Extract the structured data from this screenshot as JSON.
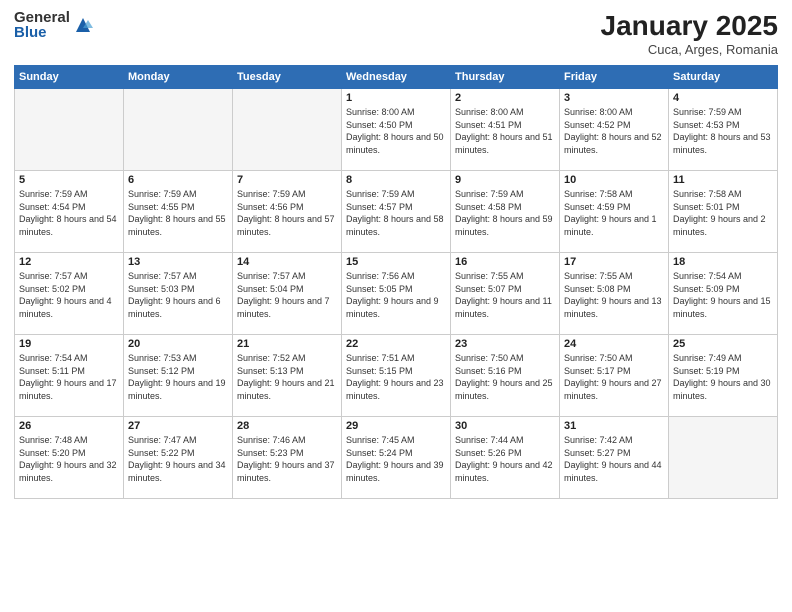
{
  "logo": {
    "general": "General",
    "blue": "Blue"
  },
  "header": {
    "month": "January 2025",
    "location": "Cuca, Arges, Romania"
  },
  "weekdays": [
    "Sunday",
    "Monday",
    "Tuesday",
    "Wednesday",
    "Thursday",
    "Friday",
    "Saturday"
  ],
  "weeks": [
    [
      {
        "day": "",
        "info": ""
      },
      {
        "day": "",
        "info": ""
      },
      {
        "day": "",
        "info": ""
      },
      {
        "day": "1",
        "sunrise": "Sunrise: 8:00 AM",
        "sunset": "Sunset: 4:50 PM",
        "daylight": "Daylight: 8 hours and 50 minutes."
      },
      {
        "day": "2",
        "sunrise": "Sunrise: 8:00 AM",
        "sunset": "Sunset: 4:51 PM",
        "daylight": "Daylight: 8 hours and 51 minutes."
      },
      {
        "day": "3",
        "sunrise": "Sunrise: 8:00 AM",
        "sunset": "Sunset: 4:52 PM",
        "daylight": "Daylight: 8 hours and 52 minutes."
      },
      {
        "day": "4",
        "sunrise": "Sunrise: 7:59 AM",
        "sunset": "Sunset: 4:53 PM",
        "daylight": "Daylight: 8 hours and 53 minutes."
      }
    ],
    [
      {
        "day": "5",
        "sunrise": "Sunrise: 7:59 AM",
        "sunset": "Sunset: 4:54 PM",
        "daylight": "Daylight: 8 hours and 54 minutes."
      },
      {
        "day": "6",
        "sunrise": "Sunrise: 7:59 AM",
        "sunset": "Sunset: 4:55 PM",
        "daylight": "Daylight: 8 hours and 55 minutes."
      },
      {
        "day": "7",
        "sunrise": "Sunrise: 7:59 AM",
        "sunset": "Sunset: 4:56 PM",
        "daylight": "Daylight: 8 hours and 57 minutes."
      },
      {
        "day": "8",
        "sunrise": "Sunrise: 7:59 AM",
        "sunset": "Sunset: 4:57 PM",
        "daylight": "Daylight: 8 hours and 58 minutes."
      },
      {
        "day": "9",
        "sunrise": "Sunrise: 7:59 AM",
        "sunset": "Sunset: 4:58 PM",
        "daylight": "Daylight: 8 hours and 59 minutes."
      },
      {
        "day": "10",
        "sunrise": "Sunrise: 7:58 AM",
        "sunset": "Sunset: 4:59 PM",
        "daylight": "Daylight: 9 hours and 1 minute."
      },
      {
        "day": "11",
        "sunrise": "Sunrise: 7:58 AM",
        "sunset": "Sunset: 5:01 PM",
        "daylight": "Daylight: 9 hours and 2 minutes."
      }
    ],
    [
      {
        "day": "12",
        "sunrise": "Sunrise: 7:57 AM",
        "sunset": "Sunset: 5:02 PM",
        "daylight": "Daylight: 9 hours and 4 minutes."
      },
      {
        "day": "13",
        "sunrise": "Sunrise: 7:57 AM",
        "sunset": "Sunset: 5:03 PM",
        "daylight": "Daylight: 9 hours and 6 minutes."
      },
      {
        "day": "14",
        "sunrise": "Sunrise: 7:57 AM",
        "sunset": "Sunset: 5:04 PM",
        "daylight": "Daylight: 9 hours and 7 minutes."
      },
      {
        "day": "15",
        "sunrise": "Sunrise: 7:56 AM",
        "sunset": "Sunset: 5:05 PM",
        "daylight": "Daylight: 9 hours and 9 minutes."
      },
      {
        "day": "16",
        "sunrise": "Sunrise: 7:55 AM",
        "sunset": "Sunset: 5:07 PM",
        "daylight": "Daylight: 9 hours and 11 minutes."
      },
      {
        "day": "17",
        "sunrise": "Sunrise: 7:55 AM",
        "sunset": "Sunset: 5:08 PM",
        "daylight": "Daylight: 9 hours and 13 minutes."
      },
      {
        "day": "18",
        "sunrise": "Sunrise: 7:54 AM",
        "sunset": "Sunset: 5:09 PM",
        "daylight": "Daylight: 9 hours and 15 minutes."
      }
    ],
    [
      {
        "day": "19",
        "sunrise": "Sunrise: 7:54 AM",
        "sunset": "Sunset: 5:11 PM",
        "daylight": "Daylight: 9 hours and 17 minutes."
      },
      {
        "day": "20",
        "sunrise": "Sunrise: 7:53 AM",
        "sunset": "Sunset: 5:12 PM",
        "daylight": "Daylight: 9 hours and 19 minutes."
      },
      {
        "day": "21",
        "sunrise": "Sunrise: 7:52 AM",
        "sunset": "Sunset: 5:13 PM",
        "daylight": "Daylight: 9 hours and 21 minutes."
      },
      {
        "day": "22",
        "sunrise": "Sunrise: 7:51 AM",
        "sunset": "Sunset: 5:15 PM",
        "daylight": "Daylight: 9 hours and 23 minutes."
      },
      {
        "day": "23",
        "sunrise": "Sunrise: 7:50 AM",
        "sunset": "Sunset: 5:16 PM",
        "daylight": "Daylight: 9 hours and 25 minutes."
      },
      {
        "day": "24",
        "sunrise": "Sunrise: 7:50 AM",
        "sunset": "Sunset: 5:17 PM",
        "daylight": "Daylight: 9 hours and 27 minutes."
      },
      {
        "day": "25",
        "sunrise": "Sunrise: 7:49 AM",
        "sunset": "Sunset: 5:19 PM",
        "daylight": "Daylight: 9 hours and 30 minutes."
      }
    ],
    [
      {
        "day": "26",
        "sunrise": "Sunrise: 7:48 AM",
        "sunset": "Sunset: 5:20 PM",
        "daylight": "Daylight: 9 hours and 32 minutes."
      },
      {
        "day": "27",
        "sunrise": "Sunrise: 7:47 AM",
        "sunset": "Sunset: 5:22 PM",
        "daylight": "Daylight: 9 hours and 34 minutes."
      },
      {
        "day": "28",
        "sunrise": "Sunrise: 7:46 AM",
        "sunset": "Sunset: 5:23 PM",
        "daylight": "Daylight: 9 hours and 37 minutes."
      },
      {
        "day": "29",
        "sunrise": "Sunrise: 7:45 AM",
        "sunset": "Sunset: 5:24 PM",
        "daylight": "Daylight: 9 hours and 39 minutes."
      },
      {
        "day": "30",
        "sunrise": "Sunrise: 7:44 AM",
        "sunset": "Sunset: 5:26 PM",
        "daylight": "Daylight: 9 hours and 42 minutes."
      },
      {
        "day": "31",
        "sunrise": "Sunrise: 7:42 AM",
        "sunset": "Sunset: 5:27 PM",
        "daylight": "Daylight: 9 hours and 44 minutes."
      },
      {
        "day": "",
        "info": ""
      }
    ]
  ]
}
